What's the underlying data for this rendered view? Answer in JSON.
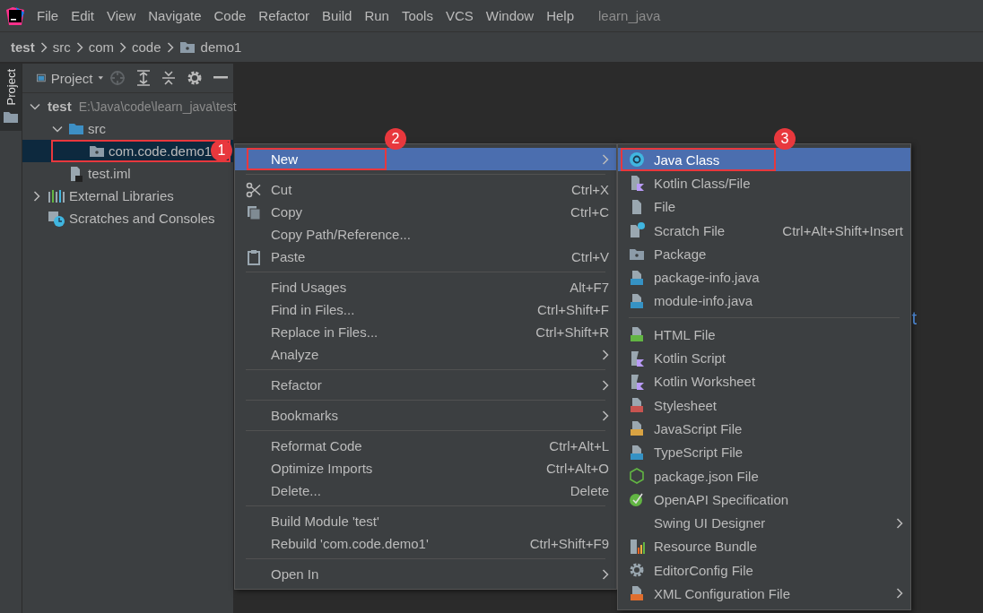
{
  "menu_bar": {
    "items": [
      "File",
      "Edit",
      "View",
      "Navigate",
      "Code",
      "Refactor",
      "Build",
      "Run",
      "Tools",
      "VCS",
      "Window",
      "Help"
    ],
    "project_title": "learn_java"
  },
  "breadcrumbs": [
    {
      "label": "test",
      "bold": true
    },
    {
      "label": "src",
      "bold": false
    },
    {
      "label": "com",
      "bold": false
    },
    {
      "label": "code",
      "bold": false
    },
    {
      "label": "demo1",
      "bold": false
    }
  ],
  "side_stripe": {
    "label": "Project"
  },
  "project_panel": {
    "title": "Project",
    "tree": [
      {
        "label": "test",
        "path": "E:\\Java\\code\\learn_java\\test",
        "expanded": true,
        "selected": false,
        "children": [
          {
            "label": "src",
            "expanded": true,
            "selected": false,
            "children": [
              {
                "label": "com.code.demo1",
                "selected": true,
                "callout": "1"
              }
            ]
          },
          {
            "label": "test.iml",
            "selected": false
          }
        ]
      },
      {
        "label": "External Libraries",
        "expanded": false,
        "selected": false
      },
      {
        "label": "Scratches and Consoles",
        "selected": false
      }
    ]
  },
  "editor": {
    "fragment": "t"
  },
  "context_menu": {
    "sections": [
      [
        {
          "label": "New",
          "submenu": true,
          "selected": true,
          "callout": "2"
        }
      ],
      [
        {
          "label": "Cut",
          "shortcut": "Ctrl+X",
          "submenu": false,
          "selected": false
        },
        {
          "label": "Copy",
          "shortcut": "Ctrl+C",
          "submenu": false,
          "selected": false
        },
        {
          "label": "Copy Path/Reference...",
          "submenu": false,
          "selected": false
        },
        {
          "label": "Paste",
          "shortcut": "Ctrl+V",
          "submenu": false,
          "selected": false
        }
      ],
      [
        {
          "label": "Find Usages",
          "shortcut": "Alt+F7",
          "submenu": false,
          "selected": false
        },
        {
          "label": "Find in Files...",
          "shortcut": "Ctrl+Shift+F",
          "submenu": false,
          "selected": false
        },
        {
          "label": "Replace in Files...",
          "shortcut": "Ctrl+Shift+R",
          "submenu": false,
          "selected": false
        },
        {
          "label": "Analyze",
          "submenu": true,
          "selected": false
        }
      ],
      [
        {
          "label": "Refactor",
          "submenu": true,
          "selected": false
        }
      ],
      [
        {
          "label": "Bookmarks",
          "submenu": true,
          "selected": false
        }
      ],
      [
        {
          "label": "Reformat Code",
          "shortcut": "Ctrl+Alt+L",
          "submenu": false,
          "selected": false
        },
        {
          "label": "Optimize Imports",
          "shortcut": "Ctrl+Alt+O",
          "submenu": false,
          "selected": false
        },
        {
          "label": "Delete...",
          "shortcut": "Delete",
          "submenu": false,
          "selected": false
        }
      ],
      [
        {
          "label": "Build Module 'test'",
          "submenu": false,
          "selected": false
        },
        {
          "label": "Rebuild 'com.code.demo1'",
          "shortcut": "Ctrl+Shift+F9",
          "submenu": false,
          "selected": false
        }
      ],
      [
        {
          "label": "Open In",
          "submenu": true,
          "selected": false
        }
      ]
    ]
  },
  "new_submenu": {
    "sections": [
      [
        {
          "label": "Java Class",
          "submenu": false,
          "selected": true,
          "callout": "3"
        },
        {
          "label": "Kotlin Class/File",
          "submenu": false,
          "selected": false
        },
        {
          "label": "File",
          "submenu": false,
          "selected": false
        },
        {
          "label": "Scratch File",
          "shortcut": "Ctrl+Alt+Shift+Insert",
          "submenu": false,
          "selected": false
        },
        {
          "label": "Package",
          "submenu": false,
          "selected": false
        },
        {
          "label": "package-info.java",
          "submenu": false,
          "selected": false
        },
        {
          "label": "module-info.java",
          "submenu": false,
          "selected": false
        }
      ],
      [
        {
          "label": "HTML File",
          "submenu": false,
          "selected": false
        },
        {
          "label": "Kotlin Script",
          "submenu": false,
          "selected": false
        },
        {
          "label": "Kotlin Worksheet",
          "submenu": false,
          "selected": false
        },
        {
          "label": "Stylesheet",
          "submenu": false,
          "selected": false
        },
        {
          "label": "JavaScript File",
          "submenu": false,
          "selected": false
        },
        {
          "label": "TypeScript File",
          "submenu": false,
          "selected": false
        },
        {
          "label": "package.json File",
          "submenu": false,
          "selected": false
        },
        {
          "label": "OpenAPI Specification",
          "submenu": false,
          "selected": false
        },
        {
          "label": "Swing UI Designer",
          "submenu": true,
          "selected": false
        },
        {
          "label": "Resource Bundle",
          "submenu": false,
          "selected": false
        },
        {
          "label": "EditorConfig File",
          "submenu": false,
          "selected": false
        },
        {
          "label": "XML Configuration File",
          "submenu": true,
          "selected": false
        }
      ]
    ]
  }
}
